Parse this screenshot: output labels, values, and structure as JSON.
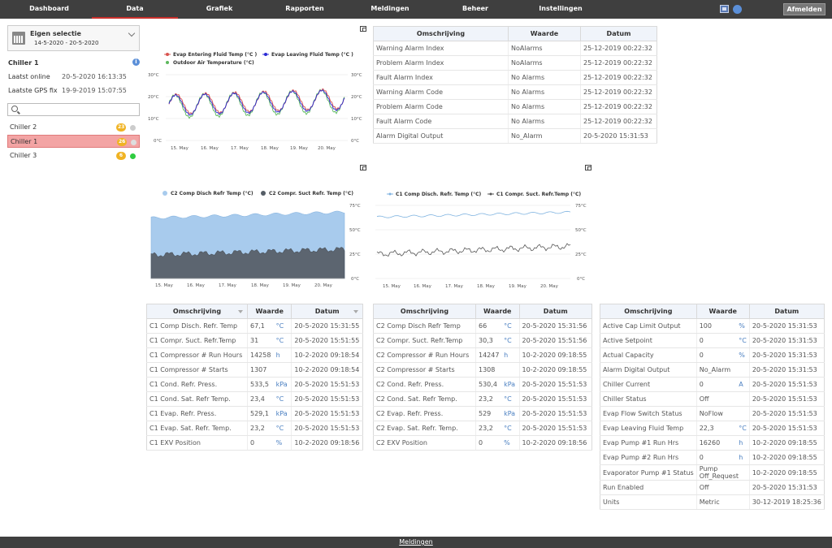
{
  "nav": {
    "items": [
      {
        "label": "Dashboard"
      },
      {
        "label": "Data"
      },
      {
        "label": "Grafiek"
      },
      {
        "label": "Rapporten"
      },
      {
        "label": "Meldingen"
      },
      {
        "label": "Beheer"
      },
      {
        "label": "Instellingen"
      }
    ],
    "active": "Data",
    "logout_label": "Afmelden",
    "icons": [
      "flag-icon",
      "user-icon"
    ]
  },
  "footer": {
    "link_label": "Meldingen"
  },
  "sidebar": {
    "date_select": {
      "title": "Eigen selectie",
      "range": "14-5-2020 - 20-5-2020"
    },
    "unit": {
      "title": "Chiller 1"
    },
    "last_online_label": "Laatst online",
    "last_online_value": "20-5-2020 16:13:35",
    "last_gps_label": "Laatste GPS fix",
    "last_gps_value": "19-9-2019 15:07:55",
    "search_placeholder": "",
    "chillers": [
      {
        "name": "Chiller 2",
        "count": "23",
        "status_color": "#cccccc",
        "selected": false
      },
      {
        "name": "Chiller 1",
        "count": "26",
        "status_color": "#dddddd",
        "selected": true
      },
      {
        "name": "Chiller 3",
        "count": "6",
        "status_color": "#2ecc40",
        "selected": false
      }
    ]
  },
  "chart_data": [
    {
      "type": "line",
      "legend": [
        "Evap Entering Fluid Temp (°C )",
        "Evap Leaving Fluid Temp (°C )",
        "Outdoor Air Temperature (°C)"
      ],
      "colors": [
        "#d9534f",
        "#2a2ad4",
        "#5cb85c"
      ],
      "y_left_ticks": [
        "30°C",
        "20°C",
        "10°C",
        "0°C"
      ],
      "y_right_ticks": [
        "30°C",
        "20°C",
        "10°C",
        "0°C"
      ],
      "x_ticks": [
        "15. May",
        "16. May",
        "17. May",
        "18. May",
        "19. May",
        "20. May"
      ],
      "ylim": [
        0,
        30
      ]
    },
    {
      "type": "area",
      "legend": [
        "C2 Comp Disch Refr Temp (°C)",
        "C2 Compr. Suct Refr. Temp (°C)"
      ],
      "colors": [
        "#a8cbed",
        "#555d66"
      ],
      "y_ticks": [
        "75°C",
        "50°C",
        "25°C",
        "0°C"
      ],
      "x_ticks": [
        "15. May",
        "16. May",
        "17. May",
        "18. May",
        "19. May",
        "20. May"
      ],
      "ylim": [
        0,
        75
      ]
    },
    {
      "type": "line",
      "legend": [
        "C1 Comp Disch. Refr. Temp (°C)",
        "C1 Compr. Suct. Refr.Temp (°C)"
      ],
      "colors": [
        "#7fb3e0",
        "#555555"
      ],
      "y_ticks": [
        "75°C",
        "50°C",
        "25°C",
        "0°C"
      ],
      "x_ticks": [
        "15. May",
        "16. May",
        "17. May",
        "18. May",
        "19. May",
        "20. May"
      ],
      "ylim": [
        0,
        75
      ]
    }
  ],
  "alarm_table": {
    "headers": [
      "Omschrijving",
      "Waarde",
      "Datum"
    ],
    "rows": [
      [
        "Warning Alarm Index",
        "NoAlarms",
        "25-12-2019 00:22:32"
      ],
      [
        "Problem Alarm Index",
        "NoAlarms",
        "25-12-2019 00:22:32"
      ],
      [
        "Fault Alarm Index",
        "No Alarms",
        "25-12-2019 00:22:32"
      ],
      [
        "Warning Alarm Code",
        "No Alarms",
        "25-12-2019 00:22:32"
      ],
      [
        "Problem Alarm Code",
        "No Alarms",
        "25-12-2019 00:22:32"
      ],
      [
        "Fault Alarm Code",
        "No Alarms",
        "25-12-2019 00:22:32"
      ],
      [
        "Alarm Digital Output",
        "No_Alarm",
        "20-5-2020 15:31:53"
      ]
    ]
  },
  "c1_table": {
    "headers": [
      "Omschrijving",
      "Waarde",
      "Datum"
    ],
    "rows": [
      [
        "C1 Comp Disch. Refr. Temp",
        "67,1",
        "°C",
        "20-5-2020 15:31:55"
      ],
      [
        "C1 Compr. Suct. Refr.Temp",
        "31",
        "°C",
        "20-5-2020 15:51:55"
      ],
      [
        "C1 Compressor # Run Hours",
        "14258",
        "h",
        "10-2-2020 09:18:54"
      ],
      [
        "C1 Compressor # Starts",
        "1307",
        "",
        "10-2-2020 09:18:54"
      ],
      [
        "C1 Cond. Refr. Press.",
        "533,5",
        "kPa",
        "20-5-2020 15:51:53"
      ],
      [
        "C1 Cond. Sat. Refr Temp.",
        "23,4",
        "°C",
        "20-5-2020 15:51:53"
      ],
      [
        "C1 Evap. Refr. Press.",
        "529,1",
        "kPa",
        "20-5-2020 15:51:53"
      ],
      [
        "C1 Evap. Sat. Refr. Temp.",
        "23,2",
        "°C",
        "20-5-2020 15:51:53"
      ],
      [
        "C1 EXV Position",
        "0",
        "%",
        "10-2-2020 09:18:56"
      ]
    ]
  },
  "c2_table": {
    "headers": [
      "Omschrijving",
      "Waarde",
      "Datum"
    ],
    "rows": [
      [
        "C2 Comp Disch Refr Temp",
        "66",
        "°C",
        "20-5-2020 15:31:56"
      ],
      [
        "C2 Compr. Suct. Refr.Temp",
        "30,3",
        "°C",
        "20-5-2020 15:51:56"
      ],
      [
        "C2 Compressor # Run Hours",
        "14247",
        "h",
        "10-2-2020 09:18:55"
      ],
      [
        "C2 Compressor # Starts",
        "1308",
        "",
        "10-2-2020 09:18:55"
      ],
      [
        "C2 Cond. Refr. Press.",
        "530,4",
        "kPa",
        "20-5-2020 15:51:53"
      ],
      [
        "C2 Cond. Sat. Refr Temp.",
        "23,2",
        "°C",
        "20-5-2020 15:51:53"
      ],
      [
        "C2 Evap. Refr. Press.",
        "529",
        "kPa",
        "20-5-2020 15:51:53"
      ],
      [
        "C2 Evap. Sat. Refr. Temp.",
        "23,2",
        "°C",
        "20-5-2020 15:51:53"
      ],
      [
        "C2 EXV Position",
        "0",
        "%",
        "10-2-2020 09:18:56"
      ]
    ]
  },
  "general_table": {
    "headers": [
      "Omschrijving",
      "Waarde",
      "Datum"
    ],
    "rows": [
      [
        "Active Cap Limit Output",
        "100",
        "%",
        "20-5-2020 15:31:53"
      ],
      [
        "Active Setpoint",
        "0",
        "°C",
        "20-5-2020 15:31:53"
      ],
      [
        "Actual Capacity",
        "0",
        "%",
        "20-5-2020 15:31:53"
      ],
      [
        "Alarm Digital Output",
        "No_Alarm",
        "",
        "20-5-2020 15:31:53"
      ],
      [
        "Chiller Current",
        "0",
        "A",
        "20-5-2020 15:51:53"
      ],
      [
        "Chiller Status",
        "Off",
        "",
        "20-5-2020 15:51:53"
      ],
      [
        "Evap Flow Switch Status",
        "NoFlow",
        "",
        "20-5-2020 15:51:53"
      ],
      [
        "Evap Leaving Fluid Temp",
        "22,3",
        "°C",
        "20-5-2020 15:51:53"
      ],
      [
        "Evap Pump #1 Run Hrs",
        "16260",
        "h",
        "10-2-2020 09:18:55"
      ],
      [
        "Evap Pump #2 Run Hrs",
        "0",
        "h",
        "10-2-2020 09:18:55"
      ],
      [
        "Evaporator Pump #1 Status",
        "Pump Off_Request",
        "",
        "10-2-2020 09:18:55"
      ],
      [
        "Run Enabled",
        "Off",
        "",
        "20-5-2020 15:31:53"
      ],
      [
        "Units",
        "Metric",
        "",
        "30-12-2019 18:25:36"
      ]
    ]
  }
}
